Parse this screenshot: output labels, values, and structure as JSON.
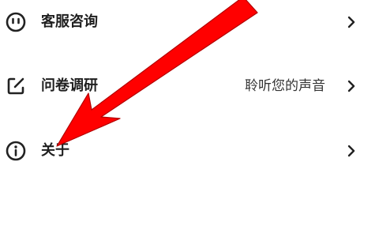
{
  "menu": {
    "items": [
      {
        "label": "客服咨询",
        "value": "",
        "icon": "smiley-face-icon"
      },
      {
        "label": "问卷调研",
        "value": "聆听您的声音",
        "icon": "edit-square-icon"
      },
      {
        "label": "关于",
        "value": "",
        "icon": "info-circle-icon"
      }
    ]
  },
  "colors": {
    "text": "#1f1f1f",
    "secondary_text": "#333333",
    "annotation": "#ff0000"
  }
}
